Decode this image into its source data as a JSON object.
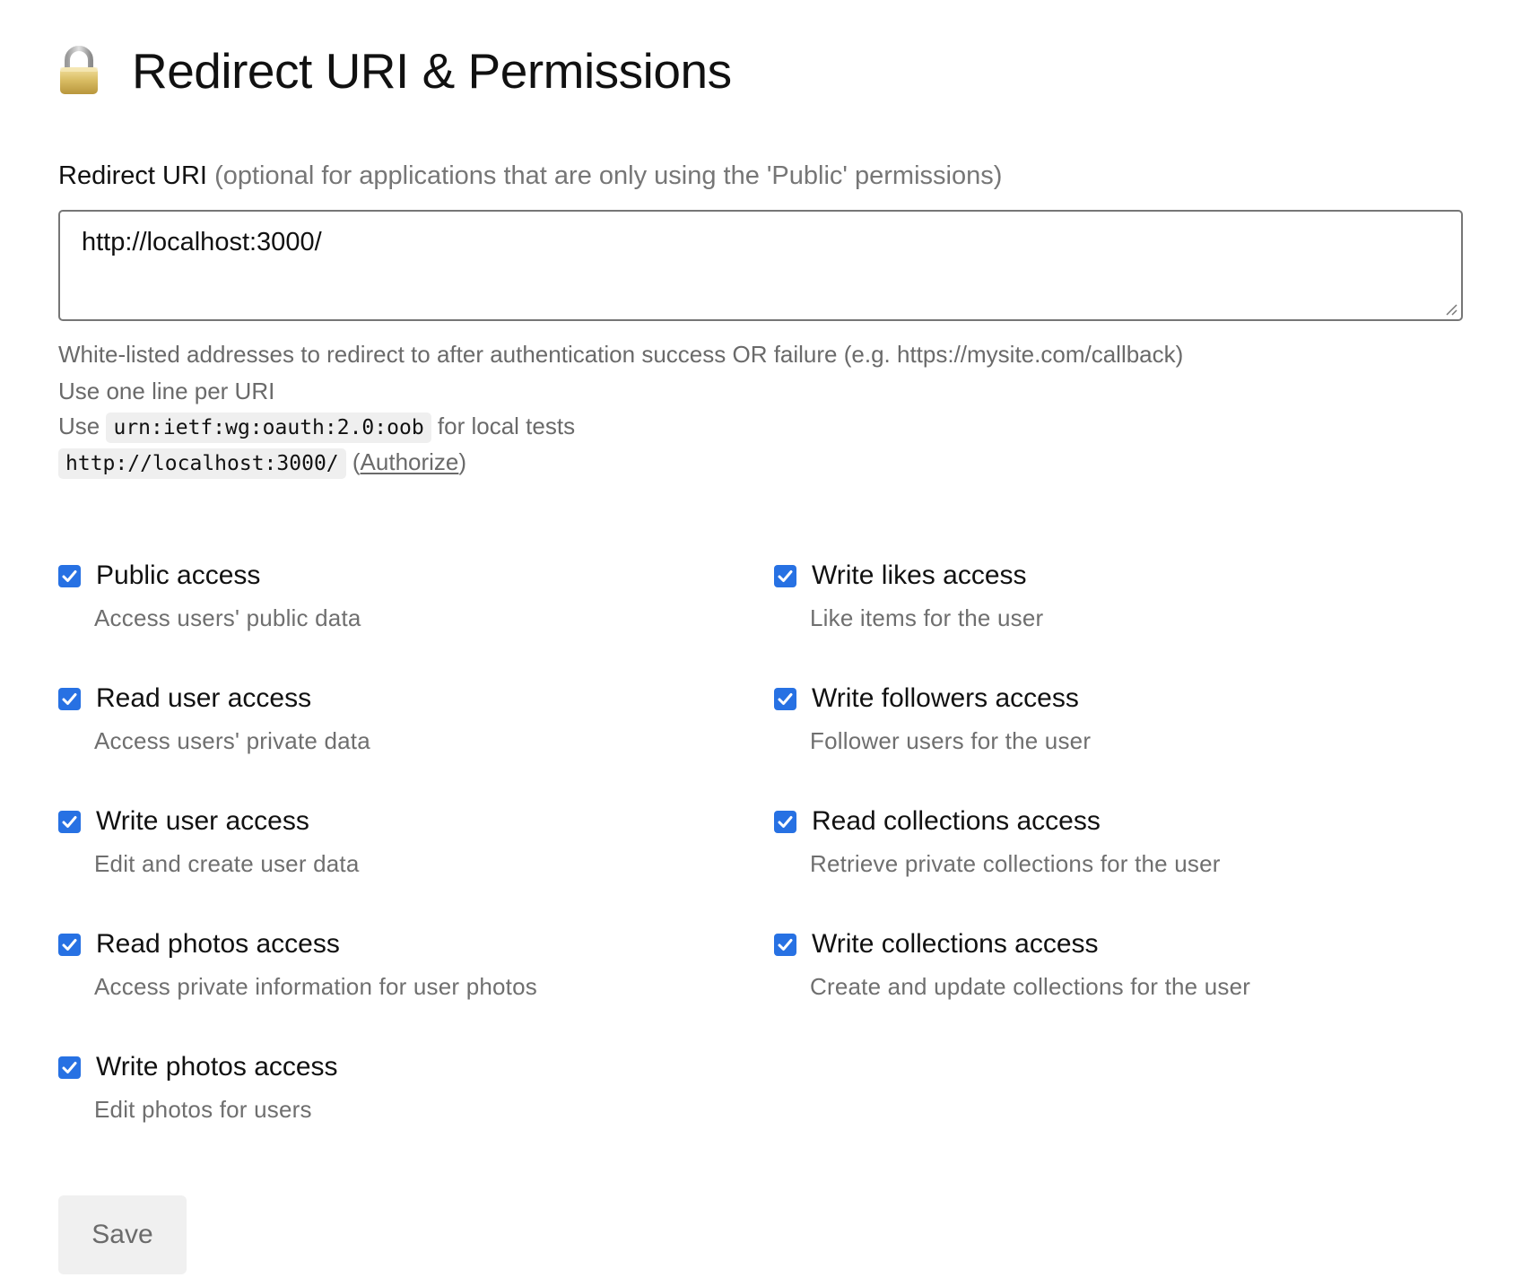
{
  "header": {
    "title": "Redirect URI & Permissions",
    "icon": "lock-icon"
  },
  "redirect": {
    "label": "Redirect URI",
    "label_hint": "(optional for applications that are only using the 'Public' permissions)",
    "value": "http://localhost:3000/",
    "help_line1": "White-listed addresses to redirect to after authentication success OR failure (e.g. https://mysite.com/callback)",
    "help_line2": "Use one line per URI",
    "help_line3_prefix": "Use",
    "help_line3_code": "urn:ietf:wg:oauth:2.0:oob",
    "help_line3_suffix": "for local tests",
    "help_line4_code": "http://localhost:3000/",
    "help_line4_paren_open": "(",
    "help_line4_link": "Authorize",
    "help_line4_paren_close": ")"
  },
  "permissions": [
    {
      "label": "Public access",
      "description": "Access users' public data",
      "checked": true
    },
    {
      "label": "Read user access",
      "description": "Access users' private data",
      "checked": true
    },
    {
      "label": "Write user access",
      "description": "Edit and create user data",
      "checked": true
    },
    {
      "label": "Read photos access",
      "description": "Access private information for user photos",
      "checked": true
    },
    {
      "label": "Write photos access",
      "description": "Edit photos for users",
      "checked": true
    },
    {
      "label": "Write likes access",
      "description": "Like items for the user",
      "checked": true
    },
    {
      "label": "Write followers access",
      "description": "Follower users for the user",
      "checked": true
    },
    {
      "label": "Read collections access",
      "description": "Retrieve private collections for the user",
      "checked": true
    },
    {
      "label": "Write collections access",
      "description": "Create and update collections for the user",
      "checked": true
    }
  ],
  "actions": {
    "save_label": "Save"
  },
  "colors": {
    "checkbox": "#2771e3",
    "hint_text": "#767676",
    "button_bg": "#f0f0f0"
  }
}
